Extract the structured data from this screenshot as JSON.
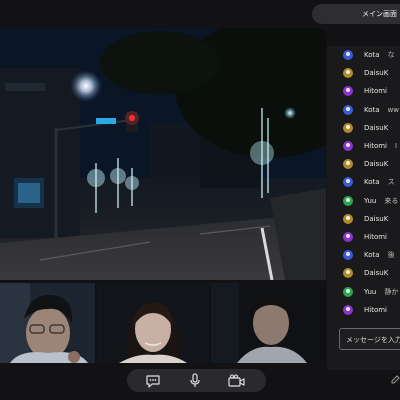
{
  "header": {
    "tab_label": "メイン画面"
  },
  "chat": {
    "messages": [
      {
        "name": "Kota",
        "text": "な",
        "avatar_color": "#3b5bd6"
      },
      {
        "name": "DaisuK",
        "text": "",
        "avatar_color": "#b08a2a"
      },
      {
        "name": "Hitomi",
        "text": "",
        "avatar_color": "#8a34c8"
      },
      {
        "name": "Kota",
        "text": "ww",
        "avatar_color": "#3b5bd6"
      },
      {
        "name": "DaisuK",
        "text": "",
        "avatar_color": "#b08a2a"
      },
      {
        "name": "Hitomi",
        "text": "I",
        "avatar_color": "#8a34c8"
      },
      {
        "name": "DaisuK",
        "text": "",
        "avatar_color": "#b08a2a"
      },
      {
        "name": "Kota",
        "text": "ス",
        "avatar_color": "#3b5bd6"
      },
      {
        "name": "Yuu",
        "text": "来る",
        "avatar_color": "#2ea44f"
      },
      {
        "name": "DaisuK",
        "text": "",
        "avatar_color": "#b08a2a"
      },
      {
        "name": "Hitomi",
        "text": "",
        "avatar_color": "#8a34c8"
      },
      {
        "name": "Kota",
        "text": "後",
        "avatar_color": "#3b5bd6"
      },
      {
        "name": "DaisuK",
        "text": "",
        "avatar_color": "#b08a2a"
      },
      {
        "name": "Yuu",
        "text": "静か",
        "avatar_color": "#2ea44f"
      },
      {
        "name": "Hitomi",
        "text": "",
        "avatar_color": "#8a34c8"
      }
    ],
    "input_placeholder": "メッセージを入力"
  },
  "toolbar": {
    "buttons": [
      {
        "icon": "chat-bubble-icon"
      },
      {
        "icon": "microphone-icon"
      },
      {
        "icon": "video-camera-icon"
      }
    ]
  },
  "colors": {
    "background": "#121214",
    "panel": "#1a1a1c",
    "toolbar": "#2a2a2e"
  }
}
